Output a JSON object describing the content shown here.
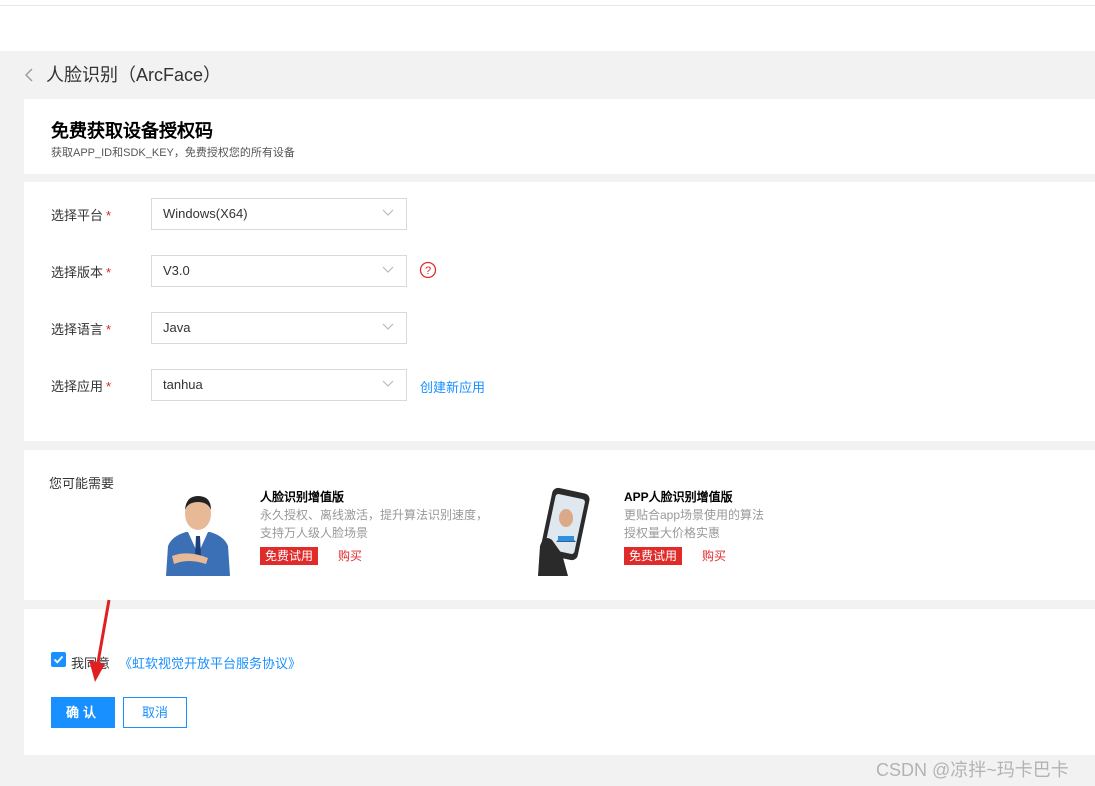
{
  "header": {
    "title": "人脸识别（ArcFace）",
    "back_icon": "chevron-left-icon"
  },
  "intro": {
    "title": "免费获取设备授权码",
    "subtitle": "获取APP_ID和SDK_KEY，免费授权您的所有设备"
  },
  "form": {
    "required_mark": "*",
    "platform": {
      "label": "选择平台",
      "value": "Windows(X64)"
    },
    "version": {
      "label": "选择版本",
      "value": "V3.0",
      "help_icon": "question-circle-icon"
    },
    "language": {
      "label": "选择语言",
      "value": "Java"
    },
    "app": {
      "label": "选择应用",
      "value": "tanhua",
      "create_link": "创建新应用"
    }
  },
  "recommend": {
    "title": "您可能需要",
    "products": [
      {
        "name": "人脸识别增值版",
        "desc": "永久授权、离线激活，提升算法识别速度，支持万人级人脸场景",
        "trial": "免费试用",
        "buy": "购买"
      },
      {
        "name": "APP人脸识别增值版",
        "desc": "更贴合app场景使用的算法授权量大价格实惠",
        "trial": "免费试用",
        "buy": "购买"
      }
    ]
  },
  "agreement": {
    "checked": true,
    "text": "我同意",
    "link": "《虹软视觉开放平台服务协议》"
  },
  "buttons": {
    "confirm": "确认",
    "cancel": "取消"
  },
  "watermark": "CSDN @凉拌~玛卡巴卡",
  "colors": {
    "accent": "#1890ff",
    "danger": "#e02b2b",
    "background": "#f2f2f2"
  }
}
